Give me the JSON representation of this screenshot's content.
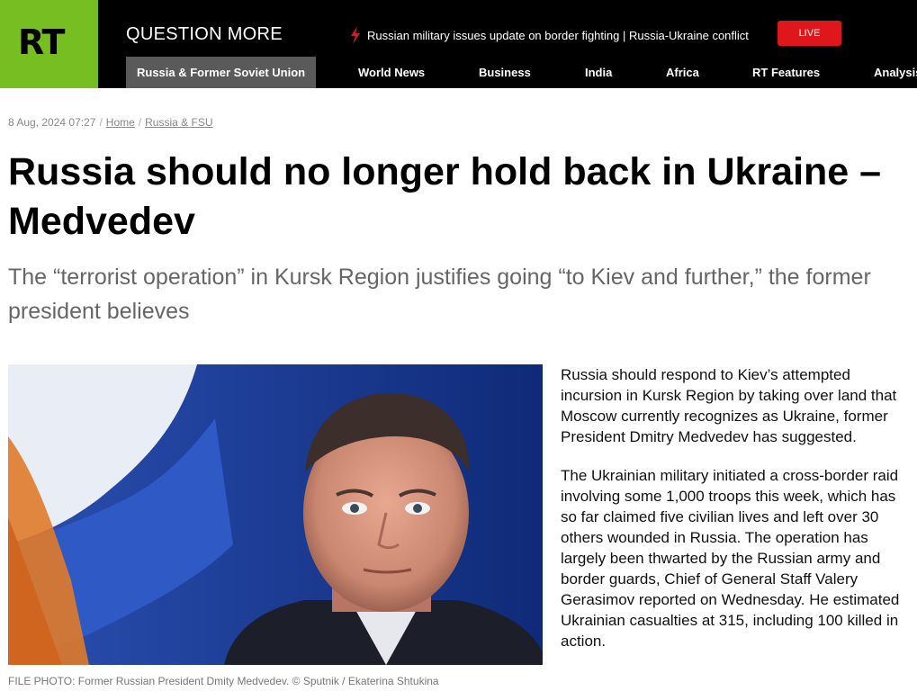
{
  "header": {
    "logo_text": "RT",
    "tagline": "QUESTION MORE",
    "breaking_text": "Russian military issues update on border fighting | Russia-Ukraine conflict",
    "live_label": "LIVE",
    "nav": [
      {
        "label": "Russia & Former Soviet Union",
        "active": true
      },
      {
        "label": "World News"
      },
      {
        "label": "Business"
      },
      {
        "label": "India"
      },
      {
        "label": "Africa"
      },
      {
        "label": "RT Features"
      },
      {
        "label": "Analysis"
      }
    ]
  },
  "article": {
    "date": "8 Aug, 2024 07:27",
    "crumbs": [
      "Home",
      "Russia & FSU"
    ],
    "headline": "Russia should no longer hold back in Ukraine – Medvedev",
    "subheadline": "The “terrorist operation” in Kursk Region justifies going “to Kiev and further,” the former president believes",
    "photo_caption": "FILE PHOTO: Former Russian President Dmity Medvedev. © Sputnik / Ekaterina Shtukina",
    "paragraphs": [
      "Russia should respond to Kiev’s attempted incursion in Kursk Region by taking over land that Moscow currently recognizes as Ukraine, former President Dmitry Medvedev has suggested.",
      "The Ukrainian military initiated a cross-border raid involving some 1,000 troops this week, which has so far claimed five civilian lives and left over 30 others wounded in Russia. The operation has largely been thwarted by the Russian army and border guards, Chief of General Staff Valery Gerasimov reported on Wednesday. He estimated Ukrainian casualties at 315, including 100 killed in action."
    ]
  },
  "colors": {
    "brand_green": "#77be22",
    "live_red": "#e0161d",
    "header_bg": "#000000",
    "nav_active_bg": "#5a5a5a"
  },
  "icons": {
    "breaking": "lightning-bolt-icon"
  }
}
